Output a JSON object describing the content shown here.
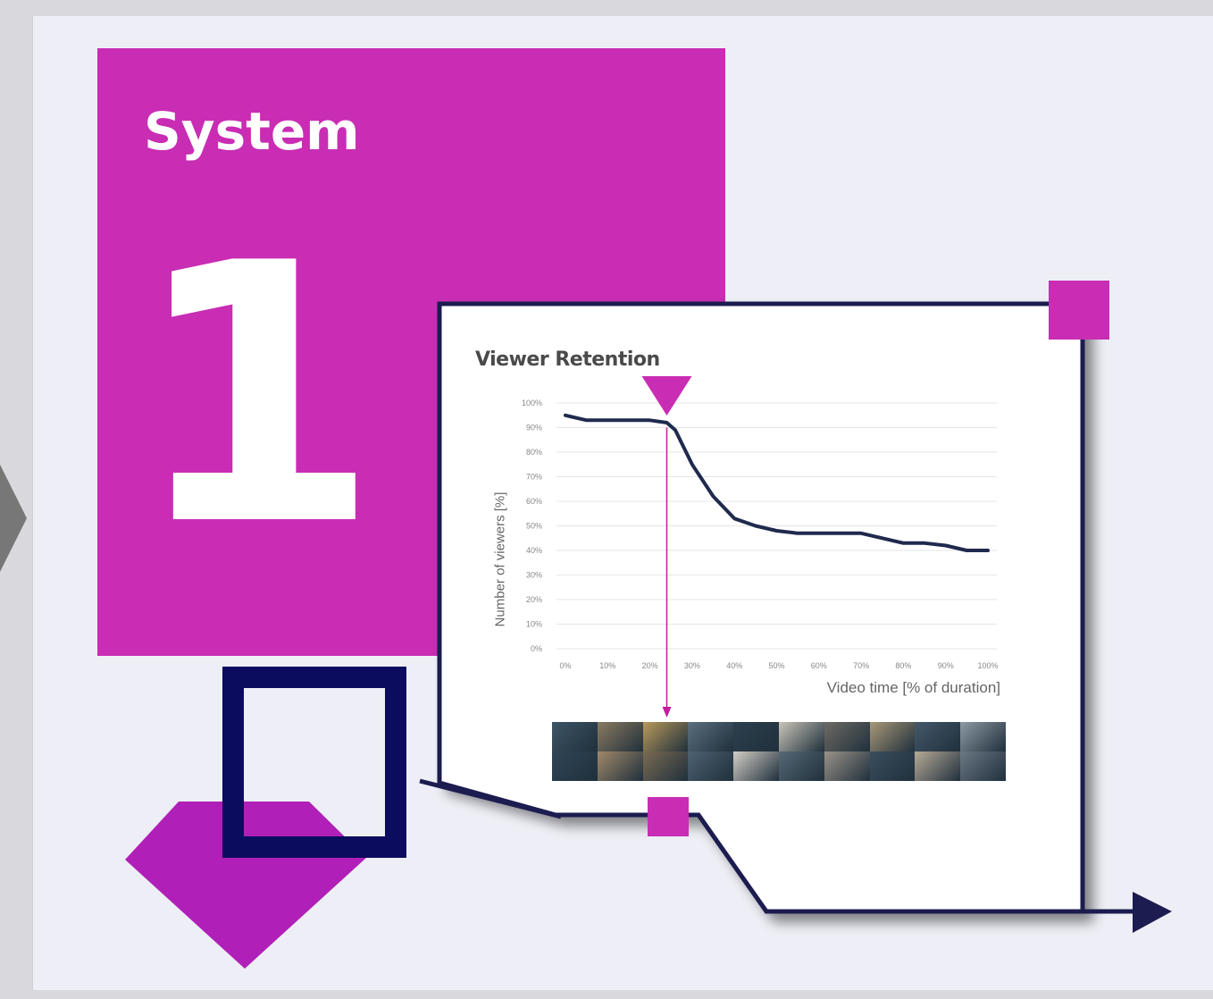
{
  "slide": {
    "title": "System",
    "number": "1"
  },
  "colors": {
    "magenta": "#c92db4",
    "navy": "#0c0c5e",
    "background": "#eeeff6",
    "line": "#1f2a4d",
    "marker": "#c41c9c"
  },
  "icons": {
    "left_arrow": "chevron-right-icon",
    "marker": "triangle-down-icon",
    "outline_square": "square-outline-icon",
    "diamond": "diamond-icon",
    "arrow": "arrow-right-icon"
  },
  "chart_data": {
    "type": "line",
    "title": "Viewer Retention",
    "xlabel": "Video time [% of duration]",
    "ylabel": "Number of viewers [%]",
    "x_ticks": [
      "0%",
      "10%",
      "20%",
      "30%",
      "40%",
      "50%",
      "60%",
      "70%",
      "80%",
      "90%",
      "100%"
    ],
    "y_ticks": [
      "0%",
      "10%",
      "20%",
      "30%",
      "40%",
      "50%",
      "60%",
      "70%",
      "80%",
      "90%",
      "100%"
    ],
    "xlim": [
      0,
      100
    ],
    "ylim": [
      0,
      100
    ],
    "grid": true,
    "series": [
      {
        "x": [
          0,
          5,
          10,
          15,
          20,
          24,
          26,
          30,
          35,
          40,
          45,
          50,
          55,
          60,
          65,
          70,
          75,
          80,
          85,
          90,
          95,
          100
        ],
        "values": [
          95,
          93,
          93,
          93,
          93,
          92,
          89,
          75,
          62,
          53,
          50,
          48,
          47,
          47,
          47,
          47,
          45,
          43,
          43,
          42,
          40,
          40
        ]
      }
    ],
    "marker_x": 24
  }
}
